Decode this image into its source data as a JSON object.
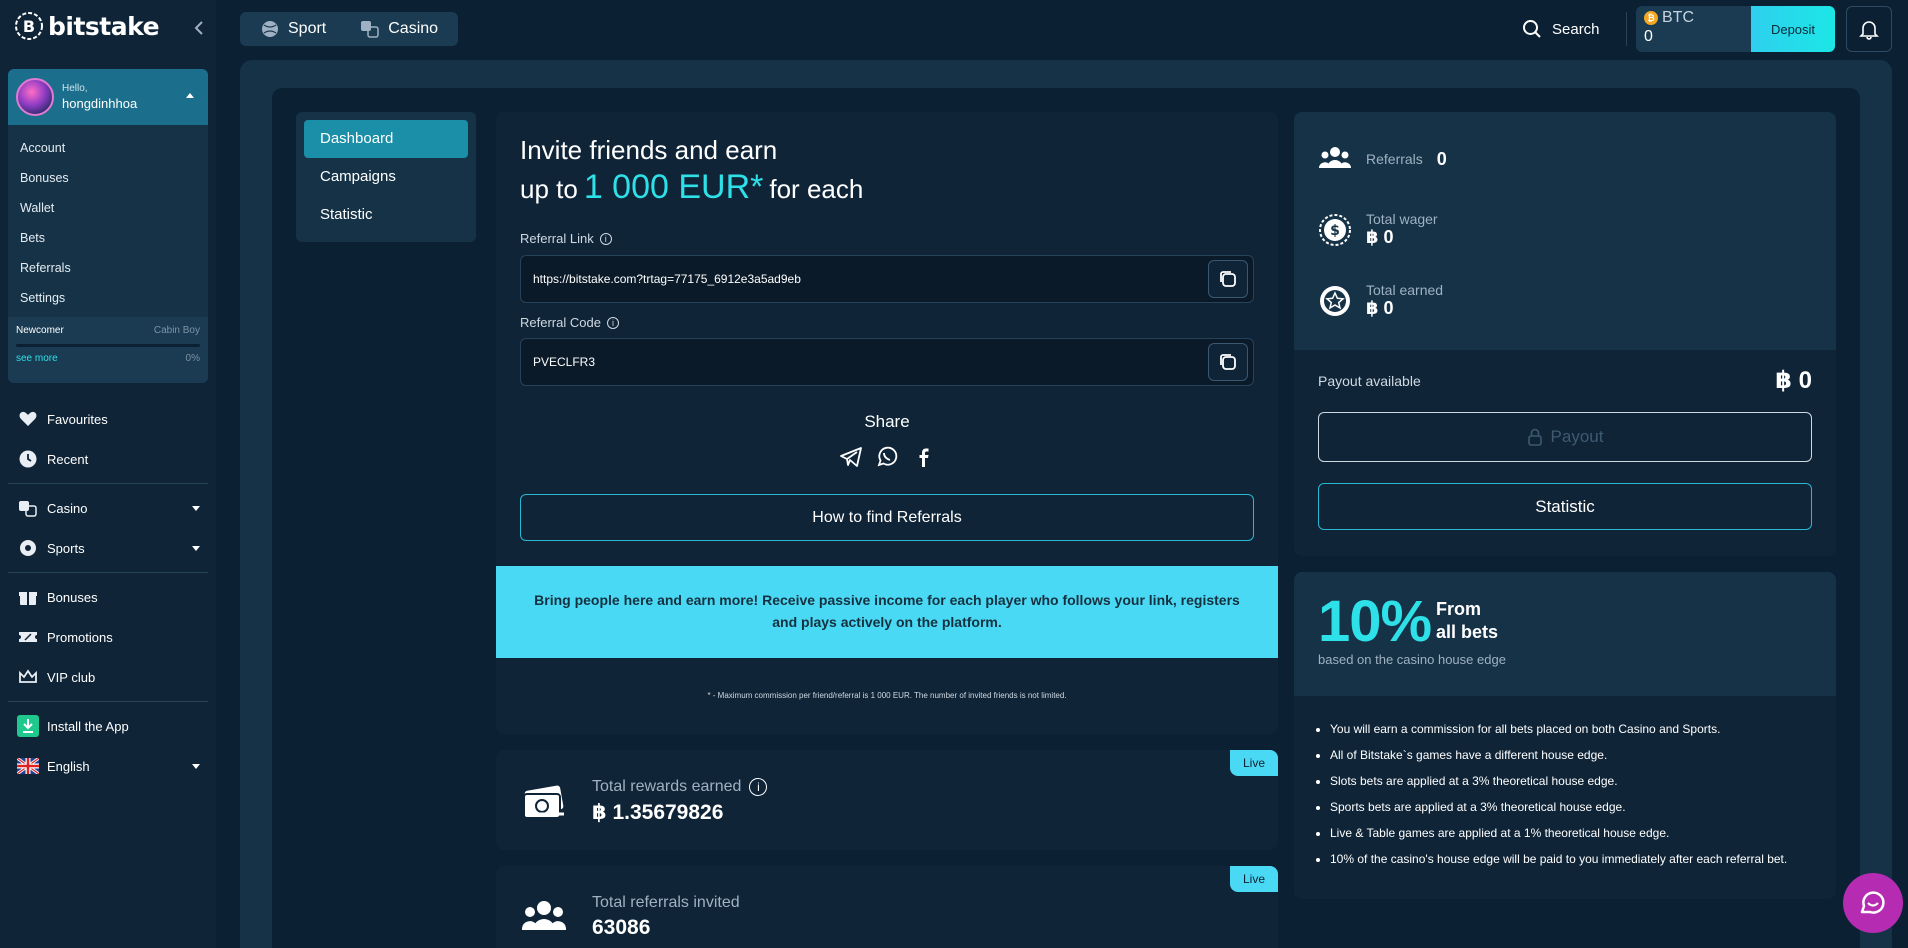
{
  "brand": {
    "name": "bitstake"
  },
  "user": {
    "greeting": "Hello,",
    "username": "hongdinhhoa",
    "menu": [
      "Account",
      "Bonuses",
      "Wallet",
      "Bets",
      "Referrals",
      "Settings"
    ],
    "rank": {
      "current": "Newcomer",
      "next": "Cabin Boy",
      "see_more": "see more",
      "progress": "0%"
    }
  },
  "sidebar": {
    "items": [
      {
        "label": "Favourites",
        "icon": "heart-icon"
      },
      {
        "label": "Recent",
        "icon": "clock-icon"
      },
      {
        "label": "Casino",
        "icon": "dice-icon",
        "dropdown": true
      },
      {
        "label": "Sports",
        "icon": "ball-icon",
        "dropdown": true
      },
      {
        "label": "Bonuses",
        "icon": "gift-icon"
      },
      {
        "label": "Promotions",
        "icon": "ticket-icon"
      },
      {
        "label": "VIP club",
        "icon": "crown-icon"
      },
      {
        "label": "Install the App",
        "icon": "download-icon"
      },
      {
        "label": "English",
        "icon": "uk-flag-icon",
        "dropdown": true
      }
    ]
  },
  "topbar": {
    "tabs": [
      "Sport",
      "Casino"
    ],
    "search": "Search",
    "wallet": {
      "currency": "BTC",
      "amount": "0"
    },
    "deposit": "Deposit"
  },
  "subnav": [
    "Dashboard",
    "Campaigns",
    "Statistic"
  ],
  "invite": {
    "title_line1": "Invite friends and earn",
    "title_prefix": "up to",
    "title_amount": "1 000 EUR*",
    "title_suffix": "for each",
    "ref_link_label": "Referral Link",
    "ref_link_value": "https://bitstake.com?trtag=77175_6912e3a5ad9eb",
    "ref_code_label": "Referral Code",
    "ref_code_value": "PVECLFR3",
    "share": "Share",
    "how_to": "How to find Referrals",
    "banner": "Bring people here and earn more! Receive passive income for each player who follows your link, registers and plays actively on the platform.",
    "footnote": "* - Maximum commission per friend/referral is 1 000 EUR. The number of invited friends is not limited."
  },
  "stats": [
    {
      "label": "Total rewards earned",
      "value": "฿ 1.35679826",
      "badge": "Live"
    },
    {
      "label": "Total referrals invited",
      "value": "63086",
      "badge": "Live"
    }
  ],
  "summary": {
    "referrals_label": "Referrals",
    "referrals_value": "0",
    "wager_label": "Total wager",
    "wager_value": "฿ 0",
    "earned_label": "Total earned",
    "earned_value": "฿ 0",
    "payout_label": "Payout available",
    "payout_value": "฿ 0",
    "payout_button": "Payout",
    "statistic_button": "Statistic"
  },
  "commission": {
    "percent": "10%",
    "from": "From",
    "all_bets": "all bets",
    "based_on": "based on the casino house edge",
    "bullets": [
      "You will earn a commission for all bets placed on both Casino and Sports.",
      "All of Bitstake`s games have a different house edge.",
      "Slots bets are applied at a 3% theoretical house edge.",
      "Sports bets are applied at a 3% theoretical house edge.",
      "Live & Table games are applied at a 1% theoretical house edge.",
      "10% of the casino's house edge will be paid to you immediately after each referral bet."
    ]
  },
  "colors": {
    "accent": "#2ee0e8",
    "banner": "#4ad9f5",
    "background": "#0b2033"
  }
}
